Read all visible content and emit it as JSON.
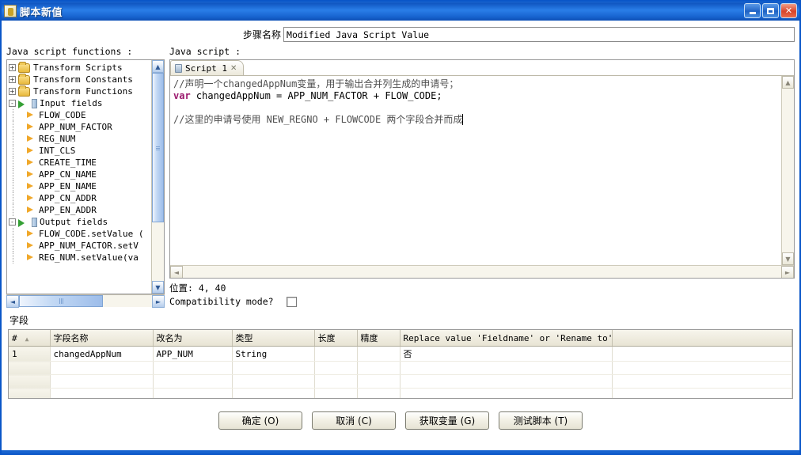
{
  "window": {
    "title": "脚本新值",
    "icon": "script-window-icon",
    "controls": {
      "minimize": "minimize",
      "maximize": "maximize",
      "close": "close"
    }
  },
  "step": {
    "label": "步骤名称",
    "value": "Modified Java Script Value"
  },
  "tree": {
    "label": "Java script functions :",
    "nodes": [
      {
        "label": "Transform Scripts",
        "icon": "folder-icon",
        "expander": "+",
        "depth": 0
      },
      {
        "label": "Transform Constants",
        "icon": "folder-icon",
        "expander": "+",
        "depth": 0
      },
      {
        "label": "Transform Functions",
        "icon": "folder-icon",
        "expander": "+",
        "depth": 0
      },
      {
        "label": "Input fields",
        "icon": "input-fields-icon",
        "expander": "-",
        "depth": 0
      },
      {
        "label": "FLOW_CODE",
        "icon": "field-arrow-icon",
        "expander": "",
        "depth": 1
      },
      {
        "label": "APP_NUM_FACTOR",
        "icon": "field-arrow-icon",
        "expander": "",
        "depth": 1
      },
      {
        "label": "REG_NUM",
        "icon": "field-arrow-icon",
        "expander": "",
        "depth": 1
      },
      {
        "label": "INT_CLS",
        "icon": "field-arrow-icon",
        "expander": "",
        "depth": 1
      },
      {
        "label": "CREATE_TIME",
        "icon": "field-arrow-icon",
        "expander": "",
        "depth": 1
      },
      {
        "label": "APP_CN_NAME",
        "icon": "field-arrow-icon",
        "expander": "",
        "depth": 1
      },
      {
        "label": "APP_EN_NAME",
        "icon": "field-arrow-icon",
        "expander": "",
        "depth": 1
      },
      {
        "label": "APP_CN_ADDR",
        "icon": "field-arrow-icon",
        "expander": "",
        "depth": 1
      },
      {
        "label": "APP_EN_ADDR",
        "icon": "field-arrow-icon",
        "expander": "",
        "depth": 1
      },
      {
        "label": "Output fields",
        "icon": "output-fields-icon",
        "expander": "-",
        "depth": 0
      },
      {
        "label": "FLOW_CODE.setValue (",
        "icon": "field-arrow-icon",
        "expander": "",
        "depth": 1
      },
      {
        "label": "APP_NUM_FACTOR.setV",
        "icon": "field-arrow-icon",
        "expander": "",
        "depth": 1
      },
      {
        "label": "REG_NUM.setValue(va",
        "icon": "field-arrow-icon",
        "expander": "",
        "depth": 1
      }
    ]
  },
  "script": {
    "label": "Java script :",
    "tab": {
      "title": "Script 1",
      "close": "✕",
      "icon": "script-tab-icon"
    },
    "code_lines": [
      {
        "type": "comment",
        "text": "//声明一个changedAppNum变量，用于输出合并列生成的申请号；"
      },
      {
        "type": "code",
        "keyword": "var",
        "rest": " changedAppNum = APP_NUM_FACTOR + FLOW_CODE;"
      },
      {
        "type": "blank",
        "text": ""
      },
      {
        "type": "comment",
        "text": "//这里的申请号使用 NEW_REGNO + FLOWCODE 两个字段合并而成"
      }
    ],
    "position_text": "位置: 4, 40",
    "compatibility_label": "Compatibility mode?",
    "compatibility_checked": false
  },
  "fields": {
    "label": "字段",
    "columns": [
      "#",
      "字段名称",
      "改名为",
      "类型",
      "长度",
      "精度",
      "Replace value 'Fieldname' or 'Rename to'",
      ""
    ],
    "rows": [
      {
        "index": "1",
        "name": "changedAppNum",
        "rename_to": "APP_NUM",
        "type": "String",
        "length": "",
        "precision": "",
        "replace": "否",
        "extra": ""
      }
    ],
    "empty_rows": 4
  },
  "buttons": [
    {
      "label": "确定 (O)",
      "name": "ok-button"
    },
    {
      "label": "取消 (C)",
      "name": "cancel-button"
    },
    {
      "label": "获取变量 (G)",
      "name": "get-variables-button"
    },
    {
      "label": "测试脚本 (T)",
      "name": "test-script-button"
    }
  ],
  "colors": {
    "title_blue": "#1763cf",
    "keyword_purple": "#9c1a6e",
    "comment_gray": "#4f4f4f",
    "folder_yellow": "#e8b93c",
    "arrow_green": "#35a035"
  }
}
